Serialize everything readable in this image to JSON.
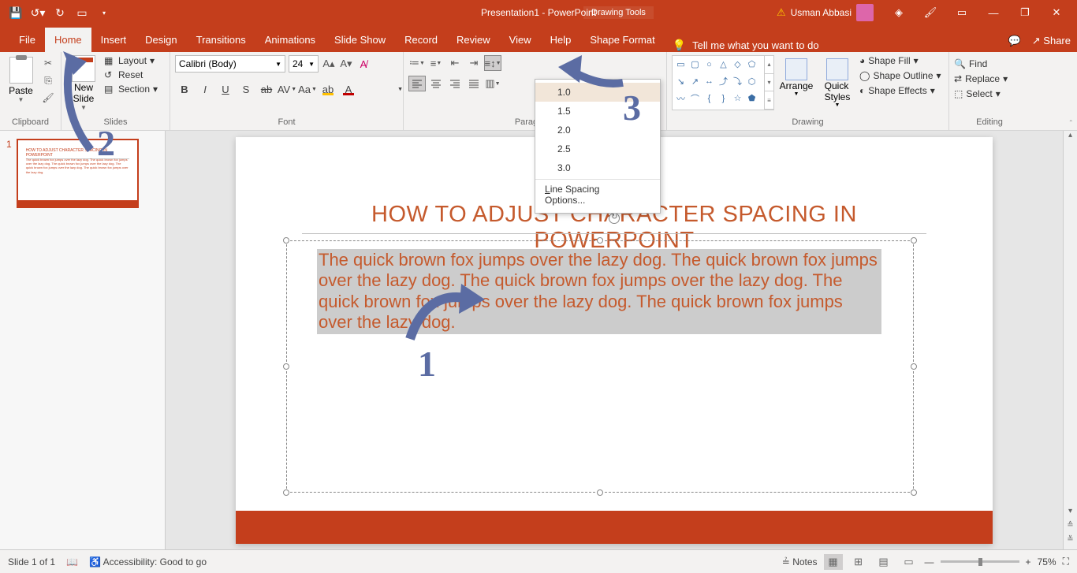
{
  "titlebar": {
    "title": "Presentation1 - PowerPoint",
    "context_tab": "Drawing Tools",
    "user_name": "Usman Abbasi"
  },
  "tabs": {
    "file": "File",
    "home": "Home",
    "insert": "Insert",
    "design": "Design",
    "transitions": "Transitions",
    "animations": "Animations",
    "slideshow": "Slide Show",
    "record": "Record",
    "review": "Review",
    "view": "View",
    "help": "Help",
    "shape_format": "Shape Format",
    "tell_me": "Tell me what you want to do",
    "share": "Share"
  },
  "ribbon": {
    "clipboard": {
      "label": "Clipboard",
      "paste": "Paste"
    },
    "slides": {
      "label": "Slides",
      "new_slide": "New\nSlide",
      "layout": "Layout",
      "reset": "Reset",
      "section": "Section"
    },
    "font": {
      "label": "Font",
      "name": "Calibri (Body)",
      "size": "24"
    },
    "paragraph": {
      "label": "Paragraph"
    },
    "line_spacing": {
      "items": [
        "1.0",
        "1.5",
        "2.0",
        "2.5",
        "3.0"
      ],
      "options": "Line Spacing Options..."
    },
    "drawing": {
      "label": "Drawing",
      "arrange": "Arrange",
      "quick_styles": "Quick\nStyles",
      "shape_fill": "Shape Fill",
      "shape_outline": "Shape Outline",
      "shape_effects": "Shape Effects"
    },
    "editing": {
      "label": "Editing",
      "find": "Find",
      "replace": "Replace",
      "select": "Select"
    }
  },
  "slide": {
    "thumb_number": "1",
    "title": "HOW TO  ADJUST CHARACTER SPACING IN POWERPOINT",
    "body": "The quick brown fox jumps over the lazy dog. The quick brown fox jumps over the lazy dog. The quick brown fox jumps over the lazy dog. The quick brown fox jumps over the lazy dog. The quick brown fox jumps over the lazy dog."
  },
  "statusbar": {
    "slide_info": "Slide 1 of 1",
    "accessibility": "Accessibility: Good to go",
    "notes": "Notes",
    "zoom": "75%"
  },
  "annotations": {
    "n1": "1",
    "n2": "2",
    "n3": "3"
  }
}
